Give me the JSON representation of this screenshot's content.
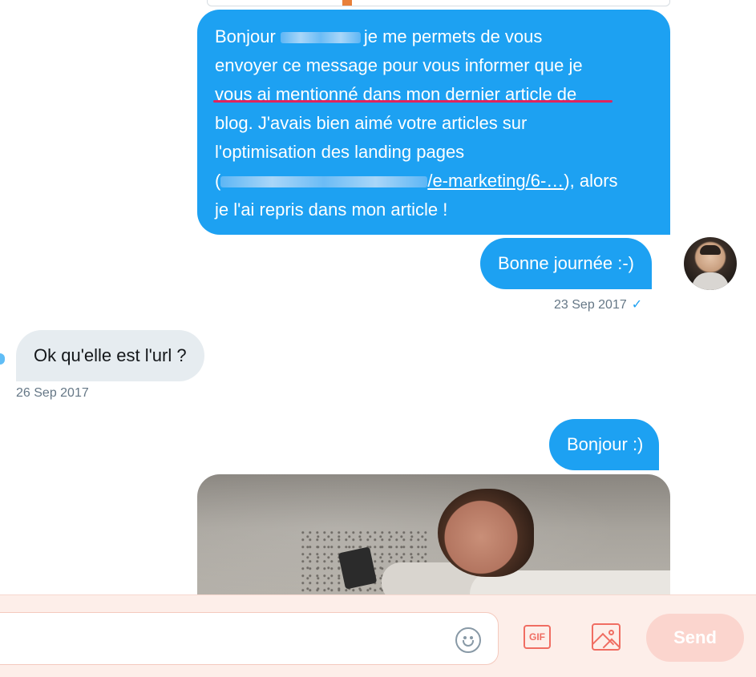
{
  "messages": [
    {
      "direction": "sent",
      "lines": [
        {
          "before": "Bonjour",
          "after": "je me permets de vous"
        },
        "envoyer ce message pour vous informer que je",
        "vous ai mentionné dans mon dernier article de",
        "blog. J'avais bien aimé votre articles sur",
        "l'optimisation des landing pages",
        {
          "open": "(",
          "link": "/e-marketing/6-…",
          "close": "), alors"
        },
        "je l'ai repris dans mon article !"
      ]
    },
    {
      "direction": "sent",
      "text": "Bonne journée :-)"
    },
    {
      "direction": "received",
      "text": "Ok qu'elle est l'url ?"
    },
    {
      "direction": "sent",
      "text": "Bonjour :)"
    }
  ],
  "timestamps": {
    "first": "23 Sep 2017",
    "first_status": "✓",
    "second": "26 Sep 2017"
  },
  "composer": {
    "placeholder": "",
    "gif_label": "GIF",
    "send_label": "Send"
  },
  "colors": {
    "sent_bubble": "#1da1f2",
    "received_bubble": "#e6ecf0",
    "highlight_underline": "#e0245e",
    "composer_accent": "#f06d62"
  },
  "icons": {
    "emoji": "emoji-icon",
    "gif": "gif-icon",
    "image": "image-icon"
  }
}
